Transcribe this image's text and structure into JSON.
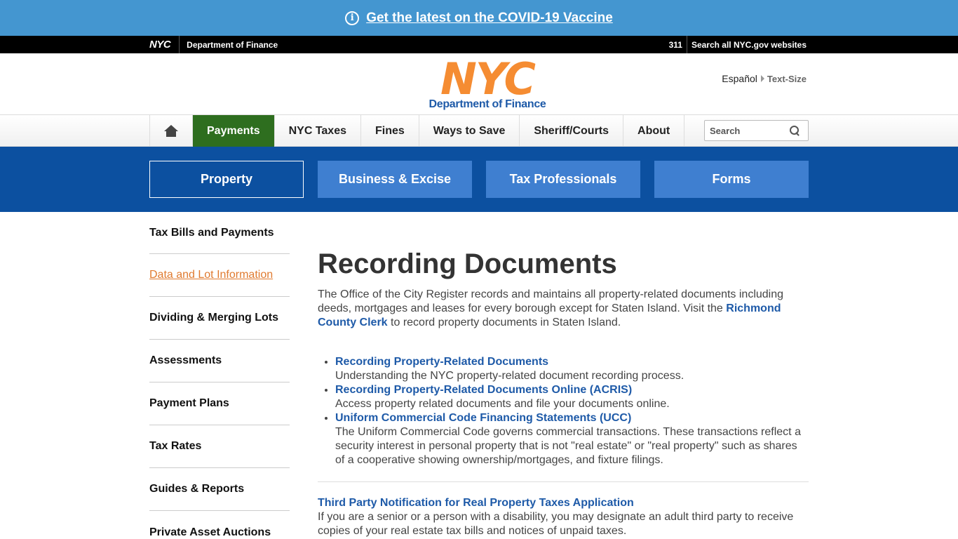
{
  "banner": {
    "info_icon": "i",
    "text": "Get the latest on the COVID-19 Vaccine"
  },
  "topbar": {
    "logo": "NYC",
    "dept": "Department of Finance",
    "three11": "311",
    "search_all": "Search all NYC.gov websites"
  },
  "header": {
    "logo_text": "NYC",
    "logo_sub": "Department of Finance",
    "espanol": "Español",
    "text_size": "Text-Size"
  },
  "mainnav": {
    "items": [
      "Payments",
      "NYC Taxes",
      "Fines",
      "Ways to Save",
      "Sheriff/Courts",
      "About"
    ],
    "search_placeholder": "Search"
  },
  "subnav": {
    "items": [
      "Property",
      "Business & Excise",
      "Tax Professionals",
      "Forms"
    ]
  },
  "sidebar": {
    "items": [
      "Tax Bills and Payments",
      "Data and Lot Information",
      "Dividing & Merging Lots",
      "Assessments",
      "Payment Plans",
      "Tax Rates",
      "Guides & Reports",
      "Private Asset Auctions"
    ]
  },
  "content": {
    "title": "Recording Documents",
    "intro_1": "The Office of the City Register records and maintains all property-related documents including deeds, mortgages and leases for every borough except for Staten Island. Visit the ",
    "intro_link": "Richmond County Clerk",
    "intro_2": " to record property documents in Staten Island.",
    "list": [
      {
        "link": "Recording Property-Related Documents",
        "desc": "Understanding the NYC property-related document recording process."
      },
      {
        "link": "Recording Property-Related Documents Online (ACRIS)",
        "desc": "Access property related documents and file your documents online."
      },
      {
        "link": "Uniform Commercial Code Financing Statements (UCC)",
        "desc": "The Uniform Commercial Code governs commercial transactions. These transactions reflect a security interest in personal property that is not \"real estate\" or \"real property\" such as shares of a cooperative showing ownership/mortgages, and fixture filings."
      }
    ],
    "third_party_link": "Third Party Notification for Real Property Taxes Application",
    "third_party_desc": "If you are a senior or a person with a disability, you may designate an adult third party to receive copies of your real estate tax bills and notices of unpaid taxes."
  }
}
